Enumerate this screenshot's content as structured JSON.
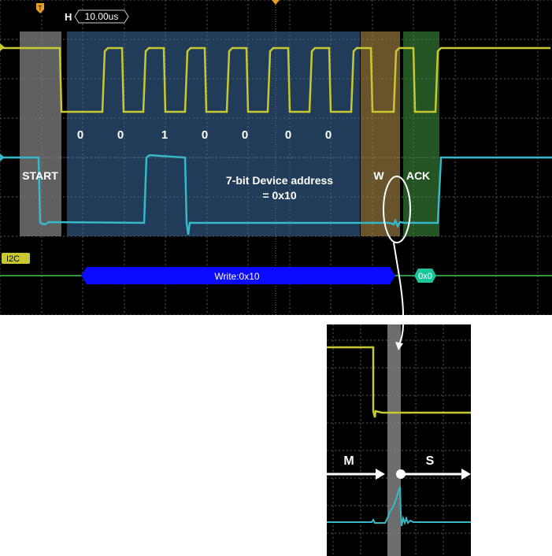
{
  "scope": {
    "horizontal_marker": "H",
    "timebase": "10.00us",
    "trigger_marker": "T",
    "bus_label": "I2C",
    "decode_write": "Write:0x10",
    "decode_ack": "0x0"
  },
  "annotations": {
    "start": "START",
    "bits": [
      "0",
      "0",
      "1",
      "0",
      "0",
      "0",
      "0"
    ],
    "address_line1": "7-bit Device address",
    "address_line2": "= 0x10",
    "write": "W",
    "ack": "ACK"
  },
  "zoom": {
    "master": "M",
    "slave": "S"
  },
  "colors": {
    "scl": "#c8c832",
    "sda": "#35b9c8",
    "bus": "#3cc850",
    "decode_fill": "#0a0aff",
    "ack_fill": "#18c89a",
    "start_overlay": "#808080",
    "address_overlay": "#3c6ea0",
    "write_overlay": "#a08040",
    "ack_overlay": "#3c8a3c"
  }
}
